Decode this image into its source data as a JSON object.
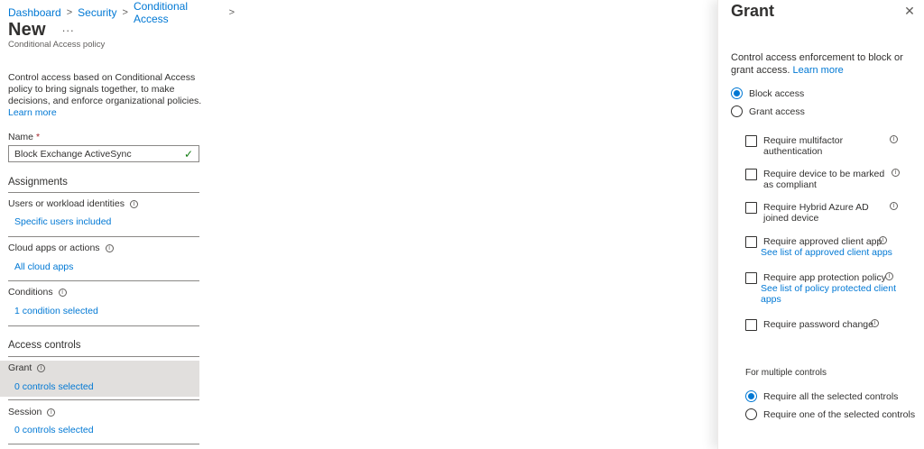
{
  "breadcrumb": {
    "items": [
      "Dashboard",
      "Security",
      "Conditional Access"
    ],
    "sep": ">"
  },
  "page": {
    "title": "New",
    "more": "...",
    "subtitle": "Conditional Access policy",
    "description": "Control access based on Conditional Access policy to bring signals together, to make decisions, and enforce organizational policies.",
    "learn_more": "Learn more"
  },
  "name_field": {
    "label": "Name",
    "required_mark": "*",
    "value": "Block Exchange ActiveSync"
  },
  "assignments": {
    "heading": "Assignments",
    "users": {
      "label": "Users or workload identities",
      "value": "Specific users included"
    },
    "apps": {
      "label": "Cloud apps or actions",
      "value": "All cloud apps"
    },
    "conditions": {
      "label": "Conditions",
      "value": "1 condition selected"
    }
  },
  "access_controls": {
    "heading": "Access controls",
    "grant": {
      "label": "Grant",
      "value": "0 controls selected"
    },
    "session": {
      "label": "Session",
      "value": "0 controls selected"
    }
  },
  "blade": {
    "title": "Grant",
    "close": "✕",
    "description": "Control access enforcement to block or grant access.",
    "learn_more": "Learn more",
    "block_access": "Block access",
    "grant_access": "Grant access",
    "selected_mode": "block",
    "controls": [
      {
        "line1": "Require multifactor",
        "line2": "authentication",
        "checked": false
      },
      {
        "line1": "Require device to be marked",
        "line2": "as compliant",
        "checked": false
      },
      {
        "line1": "Require Hybrid Azure AD",
        "line2": "joined device",
        "checked": false
      },
      {
        "line1": "Require approved client app",
        "link": "See list of approved client apps",
        "checked": false
      },
      {
        "line1": "Require app protection policy",
        "link": "See list of policy protected client apps",
        "checked": false
      },
      {
        "line1": "Require password change",
        "checked": false
      }
    ],
    "multiple_label": "For multiple controls",
    "require_all": "Require all the selected controls",
    "require_one": "Require one of the selected controls",
    "multiple_selected": "all"
  },
  "colors": {
    "accent": "#0078d4",
    "required": "#a4262c",
    "valid": "#107c10",
    "highlight": "#e1dfdd"
  },
  "icons": {
    "info": "info-icon",
    "check": "checkmark-icon",
    "close": "close-icon"
  }
}
